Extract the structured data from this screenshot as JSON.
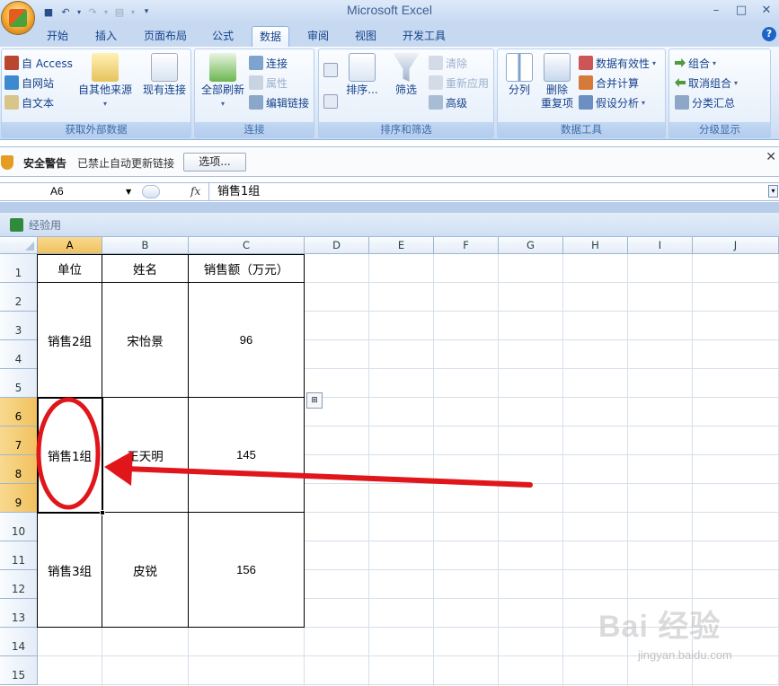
{
  "window": {
    "title": "Microsoft Excel"
  },
  "quick_access": {
    "icons": [
      "save-icon",
      "undo-icon",
      "redo-icon",
      "print-icon",
      "customize-icon"
    ]
  },
  "tabs": [
    {
      "label": "开始"
    },
    {
      "label": "插入"
    },
    {
      "label": "页面布局"
    },
    {
      "label": "公式"
    },
    {
      "label": "数据"
    },
    {
      "label": "审阅"
    },
    {
      "label": "视图"
    },
    {
      "label": "开发工具"
    }
  ],
  "active_tab": "数据",
  "ribbon": {
    "external": {
      "label": "获取外部数据",
      "access": "自 Access",
      "web": "自网站",
      "text": "自文本",
      "other": "自其他来源",
      "existing": "现有连接"
    },
    "connections": {
      "label": "连接",
      "refresh": "全部刷新",
      "conn": "连接",
      "props": "属性",
      "edit": "编辑链接"
    },
    "sort": {
      "label": "排序和筛选",
      "sort": "排序...",
      "filter": "筛选",
      "clear": "清除",
      "reapply": "重新应用",
      "advanced": "高级"
    },
    "tools": {
      "label": "数据工具",
      "split": "分列",
      "remove": "删除",
      "remove2": "重复项",
      "validation": "数据有效性",
      "consolidate": "合并计算",
      "whatif": "假设分析"
    },
    "outline": {
      "label": "分级显示",
      "group": "组合",
      "ungroup": "取消组合",
      "subtotal": "分类汇总"
    }
  },
  "security": {
    "title": "安全警告",
    "message": "已禁止自动更新链接",
    "button": "选项..."
  },
  "formula_bar": {
    "name_box": "A6",
    "fx": "fx",
    "content": "销售1组"
  },
  "workbook": {
    "name": "经验用"
  },
  "columns": [
    "A",
    "B",
    "C",
    "D",
    "E",
    "F",
    "G",
    "H",
    "I",
    "J"
  ],
  "selected_column": "A",
  "rows": [
    "1",
    "2",
    "3",
    "4",
    "5",
    "6",
    "7",
    "8",
    "9",
    "10",
    "11",
    "12",
    "13",
    "14",
    "15"
  ],
  "selected_rows": [
    "6",
    "7",
    "8",
    "9"
  ],
  "table": {
    "headers": [
      "单位",
      "姓名",
      "销售额（万元）"
    ],
    "records": [
      {
        "unit": "销售2组",
        "name": "宋怡景",
        "amount": "96"
      },
      {
        "unit": "销售1组",
        "name": "王天明",
        "amount": "145"
      },
      {
        "unit": "销售3组",
        "name": "皮锐",
        "amount": "156"
      }
    ]
  },
  "annotation": {
    "circle_color": "#e0161b",
    "arrow_color": "#e0161b"
  },
  "watermark": {
    "main": "Bai 经验",
    "sub": "jingyan.baidu.com"
  }
}
